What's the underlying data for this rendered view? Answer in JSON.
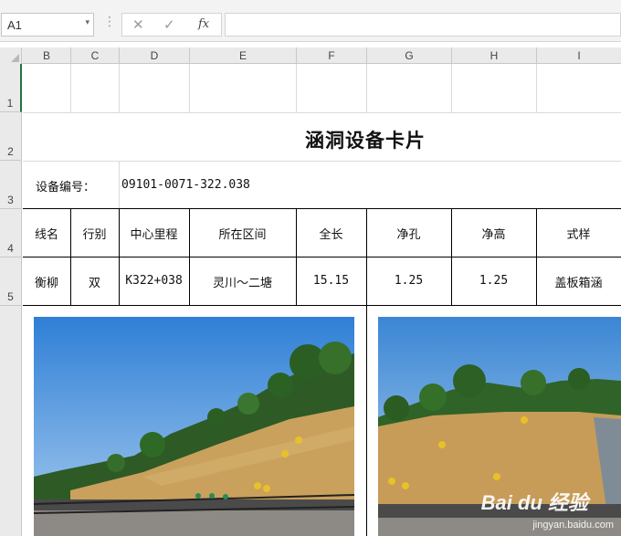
{
  "formula_bar": {
    "name_box": "A1",
    "name_box_arrow": "▾",
    "separator": "⋮",
    "cancel_icon": "✕",
    "enter_icon": "✓",
    "fx_label": "fx",
    "formula": ""
  },
  "columns": [
    "B",
    "C",
    "D",
    "E",
    "F",
    "G",
    "H",
    "I"
  ],
  "rows": [
    "1",
    "2",
    "3",
    "4",
    "5"
  ],
  "sheet": {
    "title": "涵洞设备卡片",
    "device_no_label": "设备编号：",
    "device_no_value": "09101-0071-322.038",
    "table_headers": [
      "线名",
      "行别",
      "中心里程",
      "所在区间",
      "全长",
      "净孔",
      "净高",
      "式样"
    ],
    "table_values": [
      "衡柳",
      "双",
      "K322+038",
      "灵川～二塘",
      "15.15",
      "1.25",
      "1.25",
      "盖板箱涵"
    ]
  },
  "watermark": {
    "logo": "Bai du 经验",
    "url": "jingyan.baidu.com"
  },
  "colors": {
    "excel_green": "#217346",
    "header_bg": "#eaeaea",
    "gridline": "#dadada"
  }
}
